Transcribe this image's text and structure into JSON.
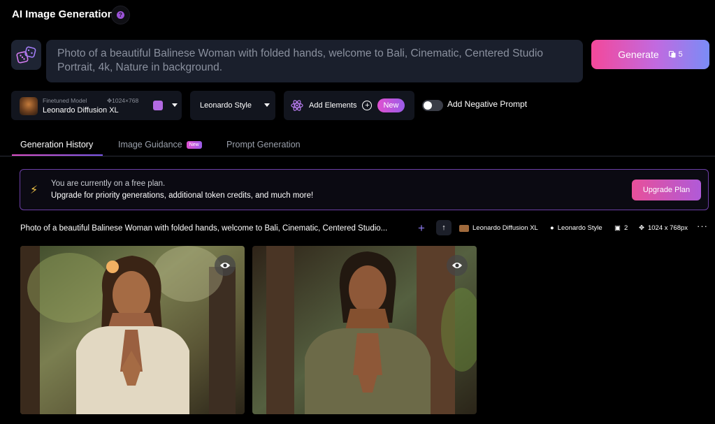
{
  "header": {
    "title": "AI Image Generation",
    "help_icon": "question-icon"
  },
  "prompt": {
    "value": "Photo of a beautiful Balinese Woman with folded hands, welcome to Bali, Cinematic, Centered Studio Portrait, 4k, Nature in background.",
    "random_icon": "dice-icon"
  },
  "generate": {
    "label": "Generate",
    "token_cost": "5",
    "accent": "#f4489a"
  },
  "model": {
    "sublabel": "Finetuned Model",
    "dimensions": "1024×768",
    "name": "Leonardo Diffusion XL"
  },
  "style": {
    "selected": "Leonardo Style"
  },
  "elements": {
    "label": "Add Elements",
    "badge": "New"
  },
  "negative_prompt": {
    "label": "Add Negative Prompt",
    "enabled": false
  },
  "tabs": [
    {
      "label": "Generation History",
      "active": true
    },
    {
      "label": "Image Guidance",
      "badge": "New"
    },
    {
      "label": "Prompt Generation"
    }
  ],
  "banner": {
    "line1": "You are currently on a free plan.",
    "line2": "Upgrade for priority generations, additional token credits, and much more!",
    "button": "Upgrade Plan"
  },
  "generation": {
    "prompt": "Photo of a beautiful Balinese Woman with folded hands, welcome to Bali, Cinematic, Centered Studio...",
    "model": "Leonardo Diffusion XL",
    "style": "Leonardo Style",
    "count": "2",
    "dimensions": "1024 x 768px"
  }
}
